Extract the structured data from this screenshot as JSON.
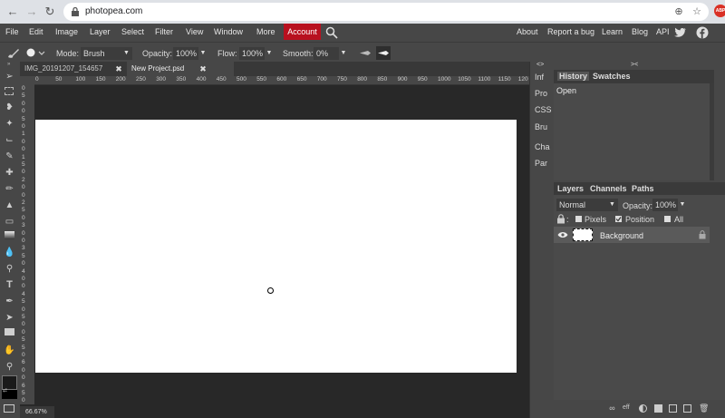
{
  "browser": {
    "url": "photopea.com",
    "back_icon": "arrow-left-icon",
    "forward_icon": "arrow-right-icon",
    "reload_icon": "reload-icon",
    "extension_badge": "ABP"
  },
  "menu": {
    "items": [
      "File",
      "Edit",
      "Image",
      "Layer",
      "Select",
      "Filter",
      "View",
      "Window",
      "More"
    ],
    "account": "Account",
    "right_links": [
      "About",
      "Report a bug",
      "Learn",
      "Blog",
      "API"
    ],
    "accent_color": "#b8101f"
  },
  "options": {
    "mode_label": "Mode:",
    "mode_value": "Brush",
    "opacity_label": "Opacity:",
    "opacity_value": "100%",
    "flow_label": "Flow:",
    "flow_value": "100%",
    "smooth_label": "Smooth:",
    "smooth_value": "0%"
  },
  "tabs": [
    {
      "label": "IMG_20191207_154657"
    },
    {
      "label": "New Project.psd"
    }
  ],
  "ruler_h": [
    "0",
    "50",
    "100",
    "150",
    "200",
    "250",
    "300",
    "350",
    "400",
    "450",
    "500",
    "550",
    "600",
    "650",
    "700",
    "750",
    "800",
    "850",
    "900",
    "950",
    "1000",
    "1050",
    "1100",
    "1150",
    "120"
  ],
  "ruler_v": [
    "0",
    "5",
    "0",
    "0",
    "5",
    "0",
    "1",
    "0",
    "0",
    "1",
    "5",
    "0",
    "2",
    "0",
    "0",
    "2",
    "5",
    "0",
    "3",
    "0",
    "0",
    "3",
    "5",
    "0",
    "4",
    "0",
    "0",
    "4",
    "5",
    "0",
    "5",
    "0",
    "0",
    "5",
    "5",
    "0",
    "6",
    "0",
    "0",
    "6",
    "5",
    "0"
  ],
  "zoom": "66.67%",
  "mini_panels": [
    "Inf",
    "Pro",
    "CSS",
    "Bru",
    "Cha",
    "Par"
  ],
  "history": {
    "tabs": [
      "History",
      "Swatches"
    ],
    "items": [
      "Open"
    ]
  },
  "layers": {
    "tabs": [
      "Layers",
      "Channels",
      "Paths"
    ],
    "blend_mode": "Normal",
    "opacity_label": "Opacity:",
    "opacity_value": "100%",
    "lock_pixels": "Pixels",
    "lock_position": "Position",
    "lock_all": "All",
    "layer_name": "Background",
    "footer_text": "eff"
  }
}
